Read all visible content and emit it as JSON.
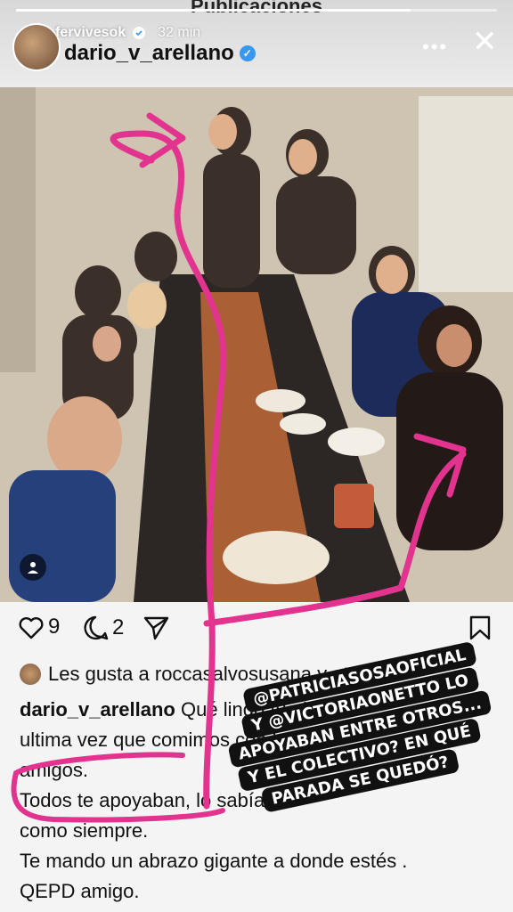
{
  "page_heading": "Publicaciones",
  "story": {
    "username": "fervivesok",
    "time": "32 min",
    "progress": 0.82
  },
  "post": {
    "username": "dario_v_arellano",
    "likes_count": "9",
    "comments_count": "2",
    "liked_by": "Les gusta a roccasalvosusana y otros",
    "caption_user": "dario_v_arellano",
    "caption_lines": [
      "Qué lindo fue la",
      "ultima vez que comimos con los",
      "amigos.",
      "Todos te apoyaban, lo sabías",
      "como siempre.",
      "Te mando un abrazo gigante a donde estés .",
      "QEPD amigo."
    ]
  },
  "overlay_text": [
    "@PATRICIASOSAOFICIAL",
    "Y @VICTORIAONETTO LO",
    "APOYABAN ENTRE OTROS...",
    "Y EL COLECTIVO? EN QUÉ",
    "PARADA SE QUEDÓ?"
  ],
  "colors": {
    "annotation_pink": "#e2338f",
    "verified": "#3897f0"
  },
  "icons": {
    "more": "more-icon",
    "close": "close-icon",
    "heart": "heart-icon",
    "comment": "comment-icon",
    "share": "share-icon",
    "bookmark": "bookmark-icon",
    "user_tag": "user-tag-icon"
  }
}
